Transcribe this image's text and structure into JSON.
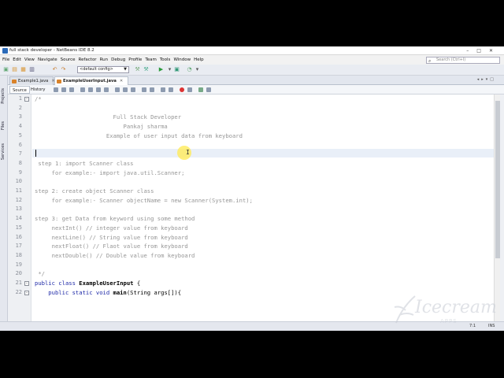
{
  "window": {
    "title": "full stack developer - NetBeans IDE 8.2",
    "controls": [
      "–",
      "□",
      "✕"
    ]
  },
  "menu": {
    "items": [
      "File",
      "Edit",
      "View",
      "Navigate",
      "Source",
      "Refactor",
      "Run",
      "Debug",
      "Profile",
      "Team",
      "Tools",
      "Window",
      "Help"
    ]
  },
  "search": {
    "placeholder": "Search (Ctrl+I)"
  },
  "toolbar": {
    "config_value": "<default config>"
  },
  "left_panels": [
    "Projects",
    "Files",
    "Services"
  ],
  "tabs": [
    {
      "label": "Example1.java",
      "active": false
    },
    {
      "label": "ExampleUserInput.java",
      "active": true
    }
  ],
  "editor_views": {
    "source": "Source",
    "history": "History"
  },
  "lines": [
    {
      "n": "1",
      "text": "/*"
    },
    {
      "n": "2",
      "text": ""
    },
    {
      "n": "3",
      "text": "                       Full Stack Developer"
    },
    {
      "n": "4",
      "text": "                          Pankaj sharma"
    },
    {
      "n": "5",
      "text": "                     Example of user input data from keyboard"
    },
    {
      "n": "6",
      "text": ""
    },
    {
      "n": "7",
      "text": ""
    },
    {
      "n": "8",
      "text": " step 1: import Scanner class"
    },
    {
      "n": "9",
      "text": "     for example:- import java.util.Scanner;"
    },
    {
      "n": "10",
      "text": ""
    },
    {
      "n": "11",
      "text": "step 2: create object Scanner class"
    },
    {
      "n": "12",
      "text": "     for example:- Scanner objectName = new Scanner(System.int);"
    },
    {
      "n": "13",
      "text": ""
    },
    {
      "n": "14",
      "text": "step 3: get Data from keyword using some method"
    },
    {
      "n": "15",
      "text": "     nextInt() // integer value from keyboard"
    },
    {
      "n": "16",
      "text": "     nextLine() // String value from keyboard"
    },
    {
      "n": "17",
      "text": "     nextFloat() // Flaot value from keyboard"
    },
    {
      "n": "18",
      "text": "     nextDouble() // Double value from keyboard"
    },
    {
      "n": "19",
      "text": ""
    },
    {
      "n": "20",
      "text": " */"
    },
    {
      "n": "21",
      "kw": "public class ",
      "bold": "ExampleUserInput",
      "tail": " {"
    },
    {
      "n": "22",
      "kw": "    public static void ",
      "bold": "main",
      "tail": "(String args[]){"
    }
  ],
  "status": {
    "position": "7:1",
    "mode": "INS"
  },
  "watermark": {
    "text": "Icecream",
    "sub": "APPS"
  }
}
